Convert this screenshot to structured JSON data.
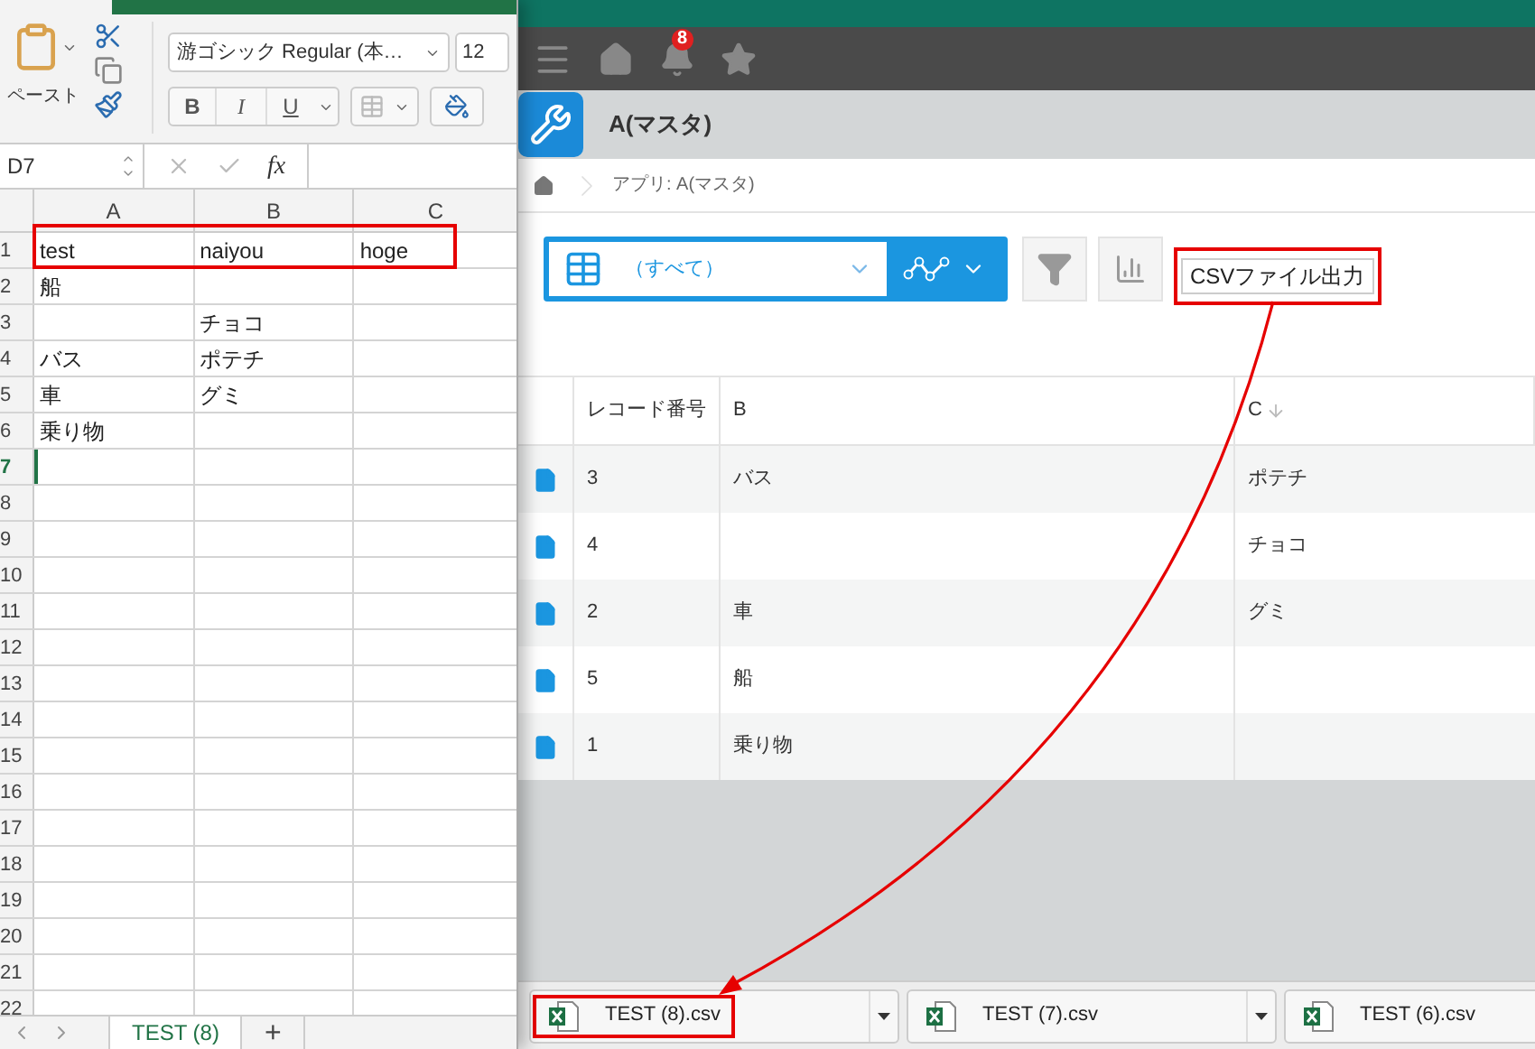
{
  "excel": {
    "ribbon": {
      "paste_label": "ペースト",
      "font_name": "游ゴシック Regular (本…",
      "font_size": "12",
      "bold": "B",
      "italic": "I",
      "underline": "U"
    },
    "name_box": "D7",
    "formula_label": "fx",
    "columns": [
      "A",
      "B",
      "C"
    ],
    "rows": [
      {
        "number": "1",
        "cells": [
          "test",
          "naiyou",
          "hoge"
        ],
        "selected": false,
        "highlighted": true
      },
      {
        "number": "2",
        "cells": [
          "船",
          "",
          ""
        ],
        "selected": false,
        "highlighted": false
      },
      {
        "number": "3",
        "cells": [
          "",
          "チョコ",
          ""
        ],
        "selected": false,
        "highlighted": false
      },
      {
        "number": "4",
        "cells": [
          "バス",
          "ポテチ",
          ""
        ],
        "selected": false,
        "highlighted": false
      },
      {
        "number": "5",
        "cells": [
          "車",
          "グミ",
          ""
        ],
        "selected": false,
        "highlighted": false
      },
      {
        "number": "6",
        "cells": [
          "乗り物",
          "",
          ""
        ],
        "selected": false,
        "highlighted": false
      },
      {
        "number": "7",
        "cells": [
          "",
          "",
          ""
        ],
        "selected": true,
        "highlighted": false
      },
      {
        "number": "8",
        "cells": [
          "",
          "",
          ""
        ],
        "selected": false,
        "highlighted": false
      },
      {
        "number": "9",
        "cells": [
          "",
          "",
          ""
        ],
        "selected": false,
        "highlighted": false
      },
      {
        "number": "10",
        "cells": [
          "",
          "",
          ""
        ],
        "selected": false,
        "highlighted": false
      },
      {
        "number": "11",
        "cells": [
          "",
          "",
          ""
        ],
        "selected": false,
        "highlighted": false
      },
      {
        "number": "12",
        "cells": [
          "",
          "",
          ""
        ],
        "selected": false,
        "highlighted": false
      },
      {
        "number": "13",
        "cells": [
          "",
          "",
          ""
        ],
        "selected": false,
        "highlighted": false
      },
      {
        "number": "14",
        "cells": [
          "",
          "",
          ""
        ],
        "selected": false,
        "highlighted": false
      },
      {
        "number": "15",
        "cells": [
          "",
          "",
          ""
        ],
        "selected": false,
        "highlighted": false
      },
      {
        "number": "16",
        "cells": [
          "",
          "",
          ""
        ],
        "selected": false,
        "highlighted": false
      },
      {
        "number": "17",
        "cells": [
          "",
          "",
          ""
        ],
        "selected": false,
        "highlighted": false
      },
      {
        "number": "18",
        "cells": [
          "",
          "",
          ""
        ],
        "selected": false,
        "highlighted": false
      },
      {
        "number": "19",
        "cells": [
          "",
          "",
          ""
        ],
        "selected": false,
        "highlighted": false
      },
      {
        "number": "20",
        "cells": [
          "",
          "",
          ""
        ],
        "selected": false,
        "highlighted": false
      },
      {
        "number": "21",
        "cells": [
          "",
          "",
          ""
        ],
        "selected": false,
        "highlighted": false
      },
      {
        "number": "22",
        "cells": [
          "",
          "",
          ""
        ],
        "selected": false,
        "highlighted": false
      }
    ],
    "sheet_tabs": [
      {
        "label": "TEST (8)",
        "selected": true
      }
    ],
    "add_sheet": "+"
  },
  "app": {
    "notification_count": "8",
    "title": "A(マスタ)",
    "breadcrumb": "アプリ: A(マスタ)",
    "view": "（すべて）",
    "csv_button": {
      "label": "CSVファイル出力",
      "highlighted": true
    },
    "table": {
      "columns": [
        {
          "label": "レコード番号",
          "sorted": false
        },
        {
          "label": "B",
          "sorted": false
        },
        {
          "label": "C",
          "sorted": true
        }
      ],
      "rows": [
        {
          "record": "3",
          "b": "バス",
          "c": "ポテチ"
        },
        {
          "record": "4",
          "b": "",
          "c": "チョコ"
        },
        {
          "record": "2",
          "b": "車",
          "c": "グミ"
        },
        {
          "record": "5",
          "b": "船",
          "c": ""
        },
        {
          "record": "1",
          "b": "乗り物",
          "c": ""
        }
      ]
    },
    "downloads": [
      {
        "name": "TEST (8).csv",
        "highlighted": true
      },
      {
        "name": "TEST (7).csv",
        "highlighted": false
      },
      {
        "name": "TEST (6).csv",
        "highlighted": false
      }
    ]
  }
}
